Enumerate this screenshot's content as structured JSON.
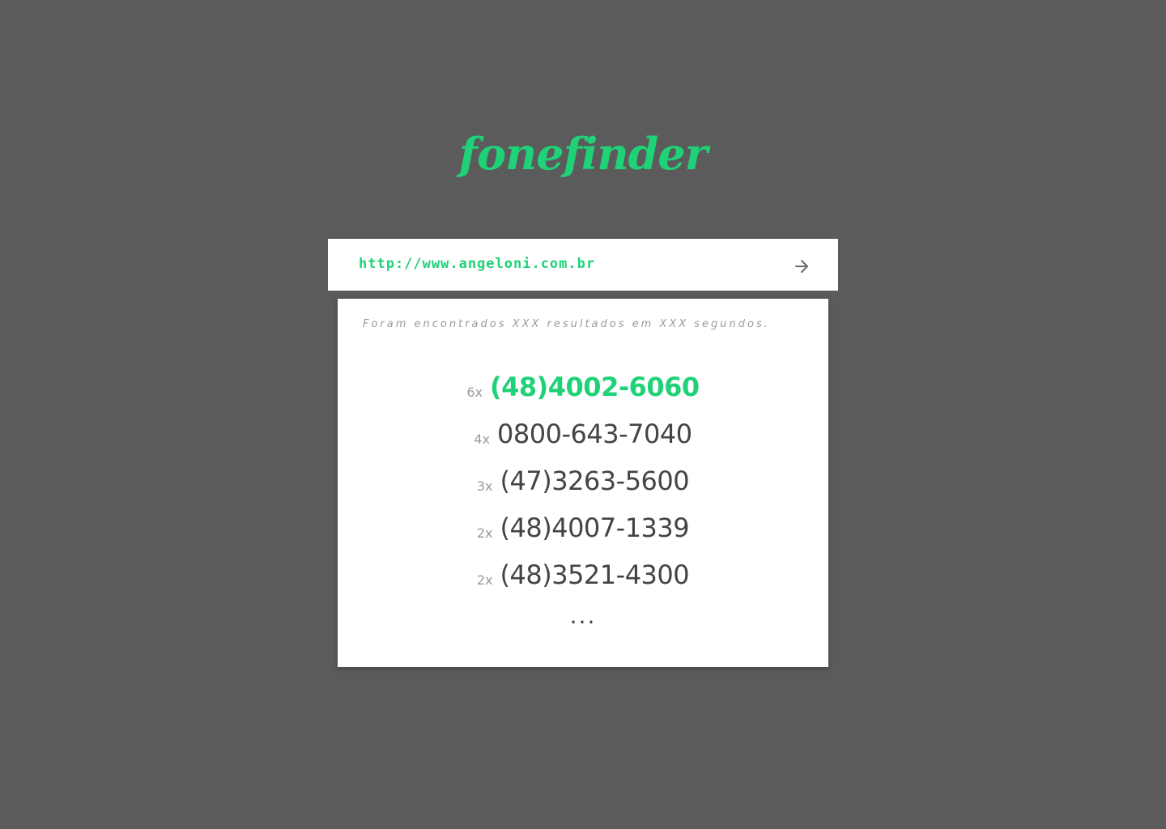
{
  "app": {
    "logo_text": "fonefinder",
    "accent_color": "#1fd177",
    "background_color": "#5b5b5b"
  },
  "search": {
    "value": "http://www.angeloni.com.br",
    "submit_icon": "arrow-right-icon"
  },
  "results": {
    "summary": "Foram encontrados XXX resultados em XXX segundos.",
    "items": [
      {
        "count": "6x",
        "phone": "(48)4002-6060"
      },
      {
        "count": "4x",
        "phone": "0800-643-7040"
      },
      {
        "count": "3x",
        "phone": "(47)3263-5600"
      },
      {
        "count": "2x",
        "phone": "(48)4007-1339"
      },
      {
        "count": "2x",
        "phone": "(48)3521-4300"
      }
    ],
    "more_label": "..."
  }
}
